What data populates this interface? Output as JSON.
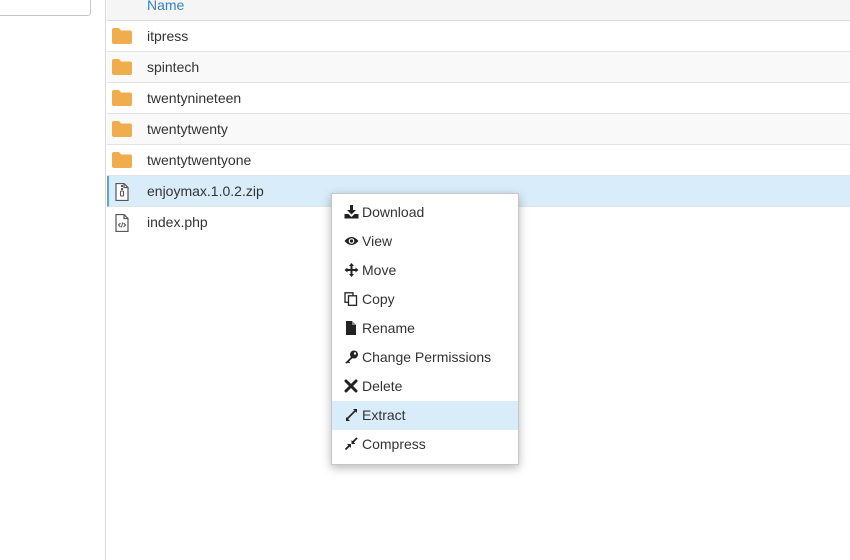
{
  "file_table": {
    "header": {
      "name_label": "Name"
    },
    "rows": [
      {
        "name": "itpress",
        "type": "folder"
      },
      {
        "name": "spintech",
        "type": "folder"
      },
      {
        "name": "twentynineteen",
        "type": "folder"
      },
      {
        "name": "twentytwenty",
        "type": "folder"
      },
      {
        "name": "twentytwentyone",
        "type": "folder"
      },
      {
        "name": "enjoymax.1.0.2.zip",
        "type": "zip-file",
        "selected": true
      },
      {
        "name": "index.php",
        "type": "code-file"
      }
    ]
  },
  "context_menu": {
    "items": [
      {
        "label": "Download",
        "icon": "download-icon"
      },
      {
        "label": "View",
        "icon": "eye-icon"
      },
      {
        "label": "Move",
        "icon": "move-arrows-icon"
      },
      {
        "label": "Copy",
        "icon": "copy-icon"
      },
      {
        "label": "Rename",
        "icon": "file-icon"
      },
      {
        "label": "Change Permissions",
        "icon": "key-icon"
      },
      {
        "label": "Delete",
        "icon": "x-icon"
      },
      {
        "label": "Extract",
        "icon": "expand-icon",
        "hovered": true
      },
      {
        "label": "Compress",
        "icon": "compress-icon"
      }
    ]
  },
  "colors": {
    "folder": "#f0ad4e",
    "link_blue": "#3a7fc4",
    "selected_bg": "#d9ecfa",
    "selected_border": "#5aa3dc"
  }
}
